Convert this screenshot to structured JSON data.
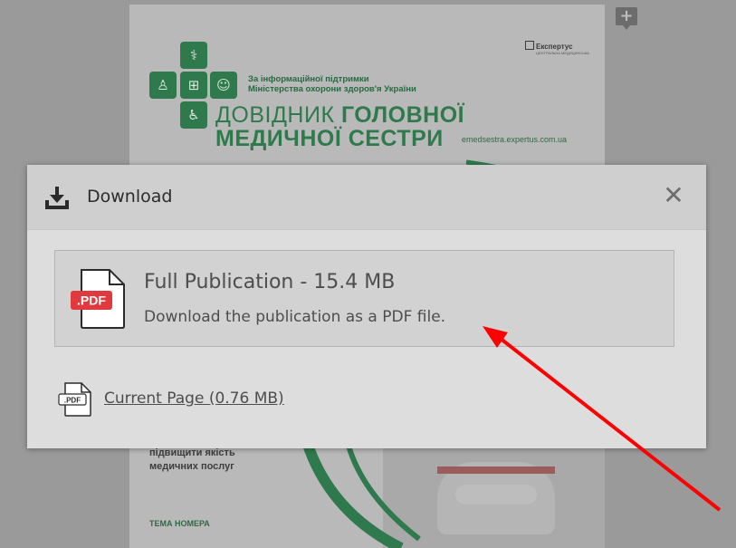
{
  "background_page": {
    "support_line1": "За інформаційної підтримки",
    "support_line2": "Міністерства охорони здоров'я України",
    "brand_name": "Експертус",
    "brand_sub": "ЦЕНТРАЛЬНА МЕДИЦИНСЬКА",
    "title_line1_regular": "ДОВІДНИК ",
    "title_line1_bold": "ГОЛОВНОЇ",
    "title_line2": "МЕДИЧНОЇ СЕСТРИ",
    "site": "emedsestra.expertus.com.ua",
    "bottom_line1": "підвищити якість",
    "bottom_line2": "медичних послуг",
    "tema": "ТЕМА НОМЕРА"
  },
  "dialog": {
    "title": "Download",
    "close_symbol": "✕",
    "full_publication": {
      "badge": ".PDF",
      "title": "Full Publication - 15.4 MB",
      "description": "Download the publication as a PDF file."
    },
    "current_page": {
      "badge": ".PDF",
      "label": "Current Page (0.76 MB)"
    }
  },
  "icons": {
    "note": "note-add-icon",
    "download": "download-tray-icon",
    "close": "close-icon",
    "pdf": "pdf-file-icon"
  },
  "colors": {
    "arrow": "#ff0000",
    "pdf_badge": "#e03a3e",
    "magazine_green": "#2f7a4c",
    "dialog_bg": "#dddddd",
    "dialog_header": "#cfcfcf"
  }
}
